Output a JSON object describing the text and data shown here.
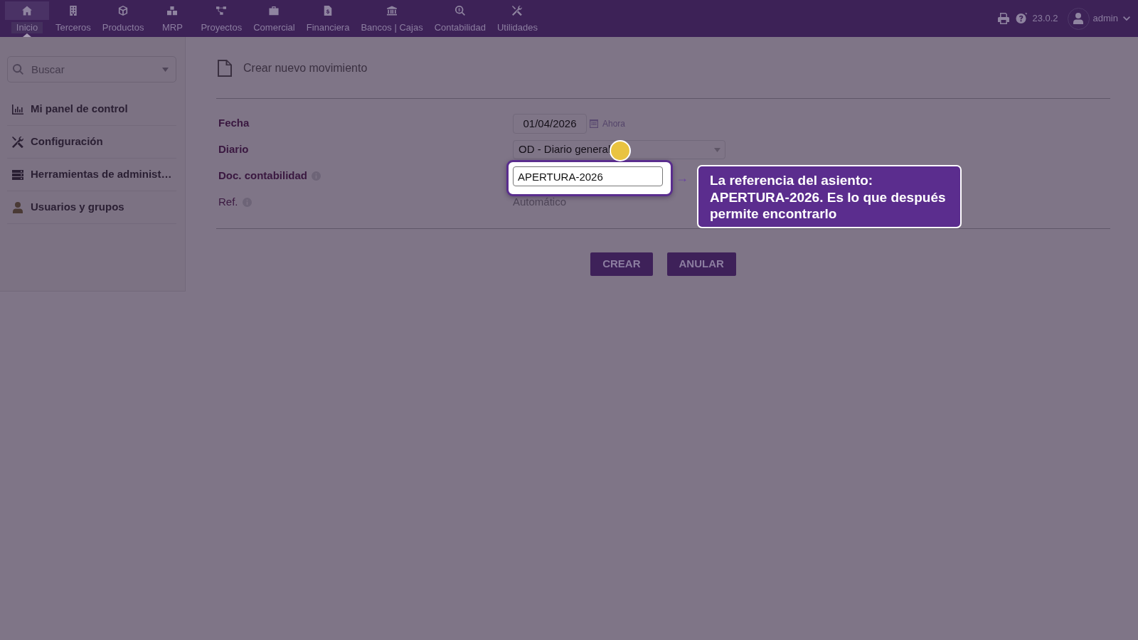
{
  "navbar": {
    "items": [
      {
        "label": "Inicio",
        "selected": true
      },
      {
        "label": "Terceros",
        "selected": false
      },
      {
        "label": "Productos",
        "selected": false
      },
      {
        "label": "MRP",
        "selected": false
      },
      {
        "label": "Proyectos",
        "selected": false
      },
      {
        "label": "Comercial",
        "selected": false
      },
      {
        "label": "Financiera",
        "selected": false
      },
      {
        "label": "Bancos | Cajas",
        "selected": false
      },
      {
        "label": "Contabilidad",
        "selected": false
      },
      {
        "label": "Utilidades",
        "selected": false
      }
    ],
    "version": "23.0.2",
    "user": "admin"
  },
  "sidebar": {
    "search": {
      "placeholder": "Buscar"
    },
    "items": [
      {
        "label": "Mi panel de control"
      },
      {
        "label": "Configuración"
      },
      {
        "label": "Herramientas de administ…"
      },
      {
        "label": "Usuarios y grupos"
      }
    ]
  },
  "form": {
    "title": "Crear nuevo movimiento",
    "fields": [
      {
        "label": "Fecha",
        "required": true,
        "info": false,
        "kind": "date",
        "value": "01/04/2026",
        "link": "Ahora"
      },
      {
        "label": "Diario",
        "required": true,
        "info": false,
        "kind": "select",
        "value": "OD - Diario general"
      },
      {
        "label": "Doc. contabilidad",
        "required": true,
        "info": true,
        "kind": "text",
        "value": "APERTURA-2026",
        "highlighted": true
      },
      {
        "label": "Ref.",
        "required": false,
        "info": true,
        "kind": "auto",
        "value": "Automático"
      }
    ],
    "buttons": [
      "CREAR",
      "ANULAR"
    ]
  },
  "tour": {
    "arrow": "→",
    "message": "La referencia del asiento: APERTURA-2026. Es lo que después permite encontrarlo"
  }
}
